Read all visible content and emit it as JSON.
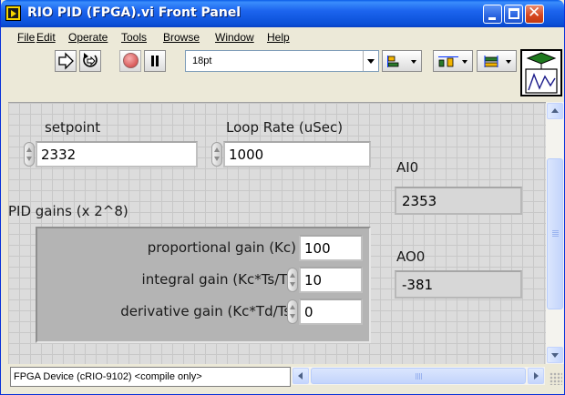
{
  "window": {
    "title": "RIO PID (FPGA).vi Front Panel",
    "close_glyph": "✕"
  },
  "menu": {
    "items": [
      "File",
      "Edit",
      "Operate",
      "Tools",
      "Browse",
      "Window",
      "Help"
    ]
  },
  "toolbar": {
    "font_size": "18pt"
  },
  "controls": {
    "setpoint": {
      "label": "setpoint",
      "value": "2332"
    },
    "loop_rate": {
      "label": "Loop Rate (uSec)",
      "value": "1000"
    }
  },
  "pid_gains": {
    "label": "PID gains (x 2^8)",
    "proportional": {
      "label": "proportional gain (Kc)",
      "value": "100"
    },
    "integral": {
      "label": "integral gain (Kc*Ts/Ti)",
      "value": "10"
    },
    "derivative": {
      "label": "derivative gain (Kc*Td/Ts)",
      "value": "0"
    }
  },
  "indicators": {
    "ai0": {
      "label": "AI0",
      "value": "2353"
    },
    "ao0": {
      "label": "AO0",
      "value": "-381"
    }
  },
  "status": {
    "execution_target": "FPGA Device (cRIO-9102) <compile only>"
  },
  "colors": {
    "titlebar": "#0a4fd6",
    "panel_background": "#dcdcdc",
    "cluster_background": "#b4b4b4",
    "close_button": "#d5451e"
  }
}
